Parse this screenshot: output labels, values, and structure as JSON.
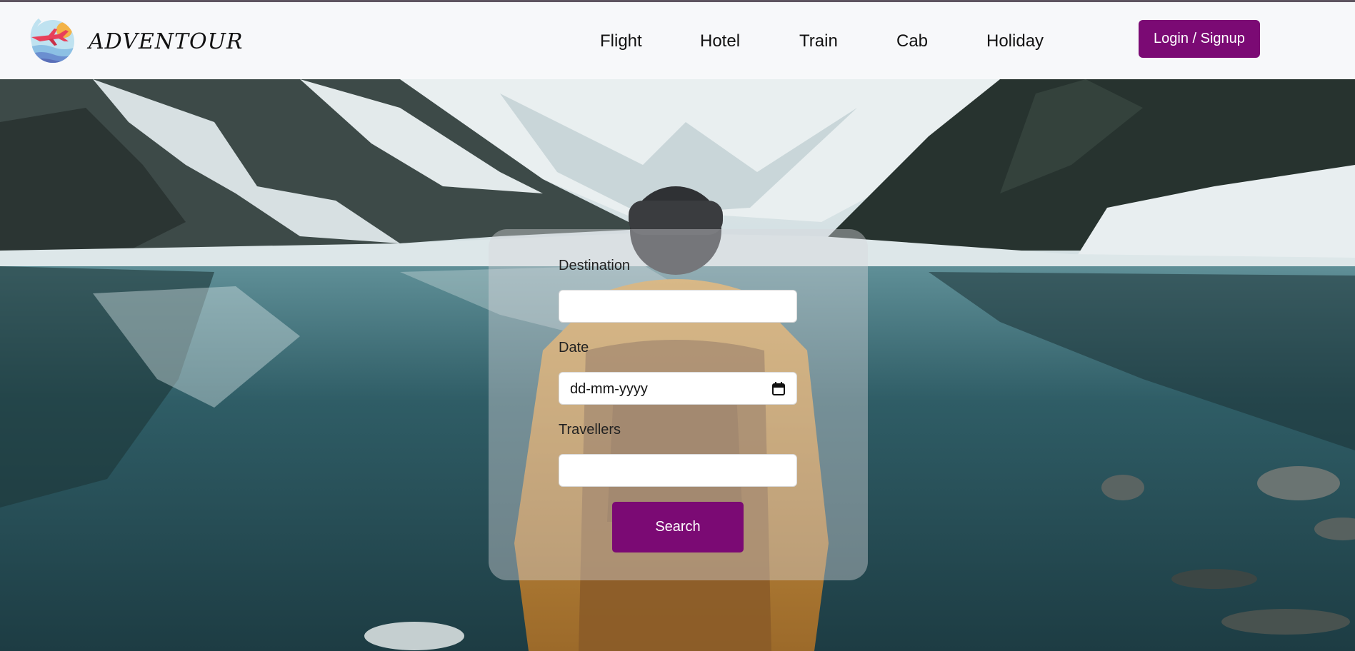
{
  "brand": {
    "name": "ADVENTOUR"
  },
  "nav": {
    "links": [
      "Flight",
      "Hotel",
      "Train",
      "Cab",
      "Holiday"
    ],
    "login_label": "Login / Signup"
  },
  "search_form": {
    "destination_label": "Destination",
    "destination_value": "",
    "date_label": "Date",
    "date_placeholder": "dd-mm-yyyy",
    "travellers_label": "Travellers",
    "travellers_value": "",
    "search_label": "Search"
  },
  "colors": {
    "accent": "#7b0a74",
    "navbar_bg": "#f7f8fa"
  },
  "icons": {
    "logo": "plane-sun-logo-icon",
    "date_picker": "calendar-icon"
  }
}
